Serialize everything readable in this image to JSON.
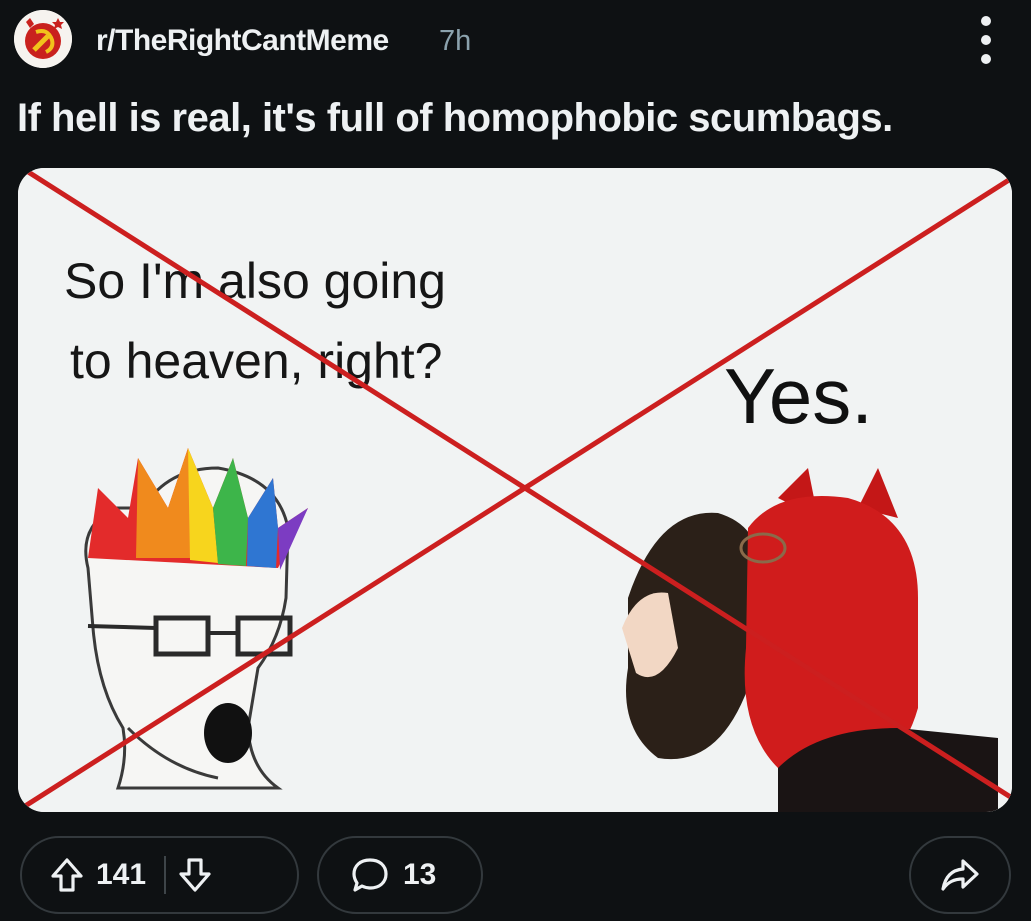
{
  "post": {
    "subreddit": "r/TheRightCantMeme",
    "age": "7h",
    "title": "If hell is real, it's full of homophobic scumbags."
  },
  "meme": {
    "left_text_line1": "So I'm also going",
    "left_text_line2": "to heaven, right?",
    "right_text": "Yes.",
    "cross_color": "#cc1f1f"
  },
  "actions": {
    "upvotes": "141",
    "comments": "13"
  },
  "icons": {
    "avatar": "hammer-sickle-avatar-icon",
    "more": "more-vertical-icon",
    "upvote": "upvote-arrow-icon",
    "downvote": "downvote-arrow-icon",
    "comment": "comment-bubble-icon",
    "share": "share-arrow-icon"
  }
}
